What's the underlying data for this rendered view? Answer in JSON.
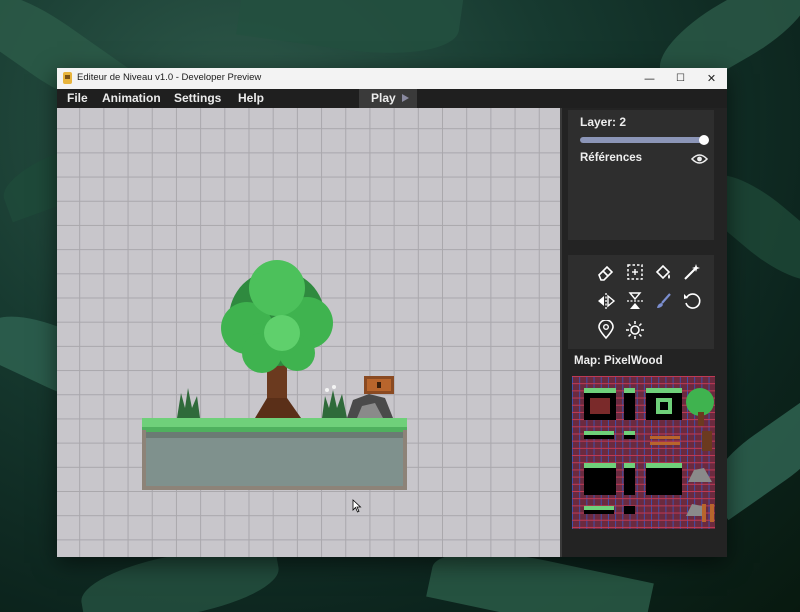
{
  "window": {
    "title": "Editeur de Niveau v1.0 - Developer Preview",
    "controls": {
      "minimize": "—",
      "maximize": "☐",
      "close": "✕"
    }
  },
  "menu": {
    "items": [
      "File",
      "Animation",
      "Settings",
      "Help"
    ],
    "play_label": "Play"
  },
  "layers_panel": {
    "layer_label": "Layer: 2",
    "slider_level": 1.0,
    "references_label": "Références"
  },
  "tools": [
    "eraser-icon",
    "select-rectangle-icon",
    "fill-bucket-icon",
    "magic-wand-icon",
    "flip-horizontal-icon",
    "flip-vertical-icon",
    "brush-icon",
    "rotate-icon",
    "location-pin-icon",
    "light-icon"
  ],
  "map": {
    "label": "Map: PixelWood"
  },
  "colors": {
    "canvas_bg": "#c8c6cb",
    "grid_line": "#a9a7ac",
    "sidebar_bg": "#232323",
    "panel_bg": "#2e2e2e",
    "slider_track": "#8c96b8",
    "tileset_bg": "#6b2a3f",
    "grass": "#6fd07a",
    "foliage": "#3fb34f"
  }
}
